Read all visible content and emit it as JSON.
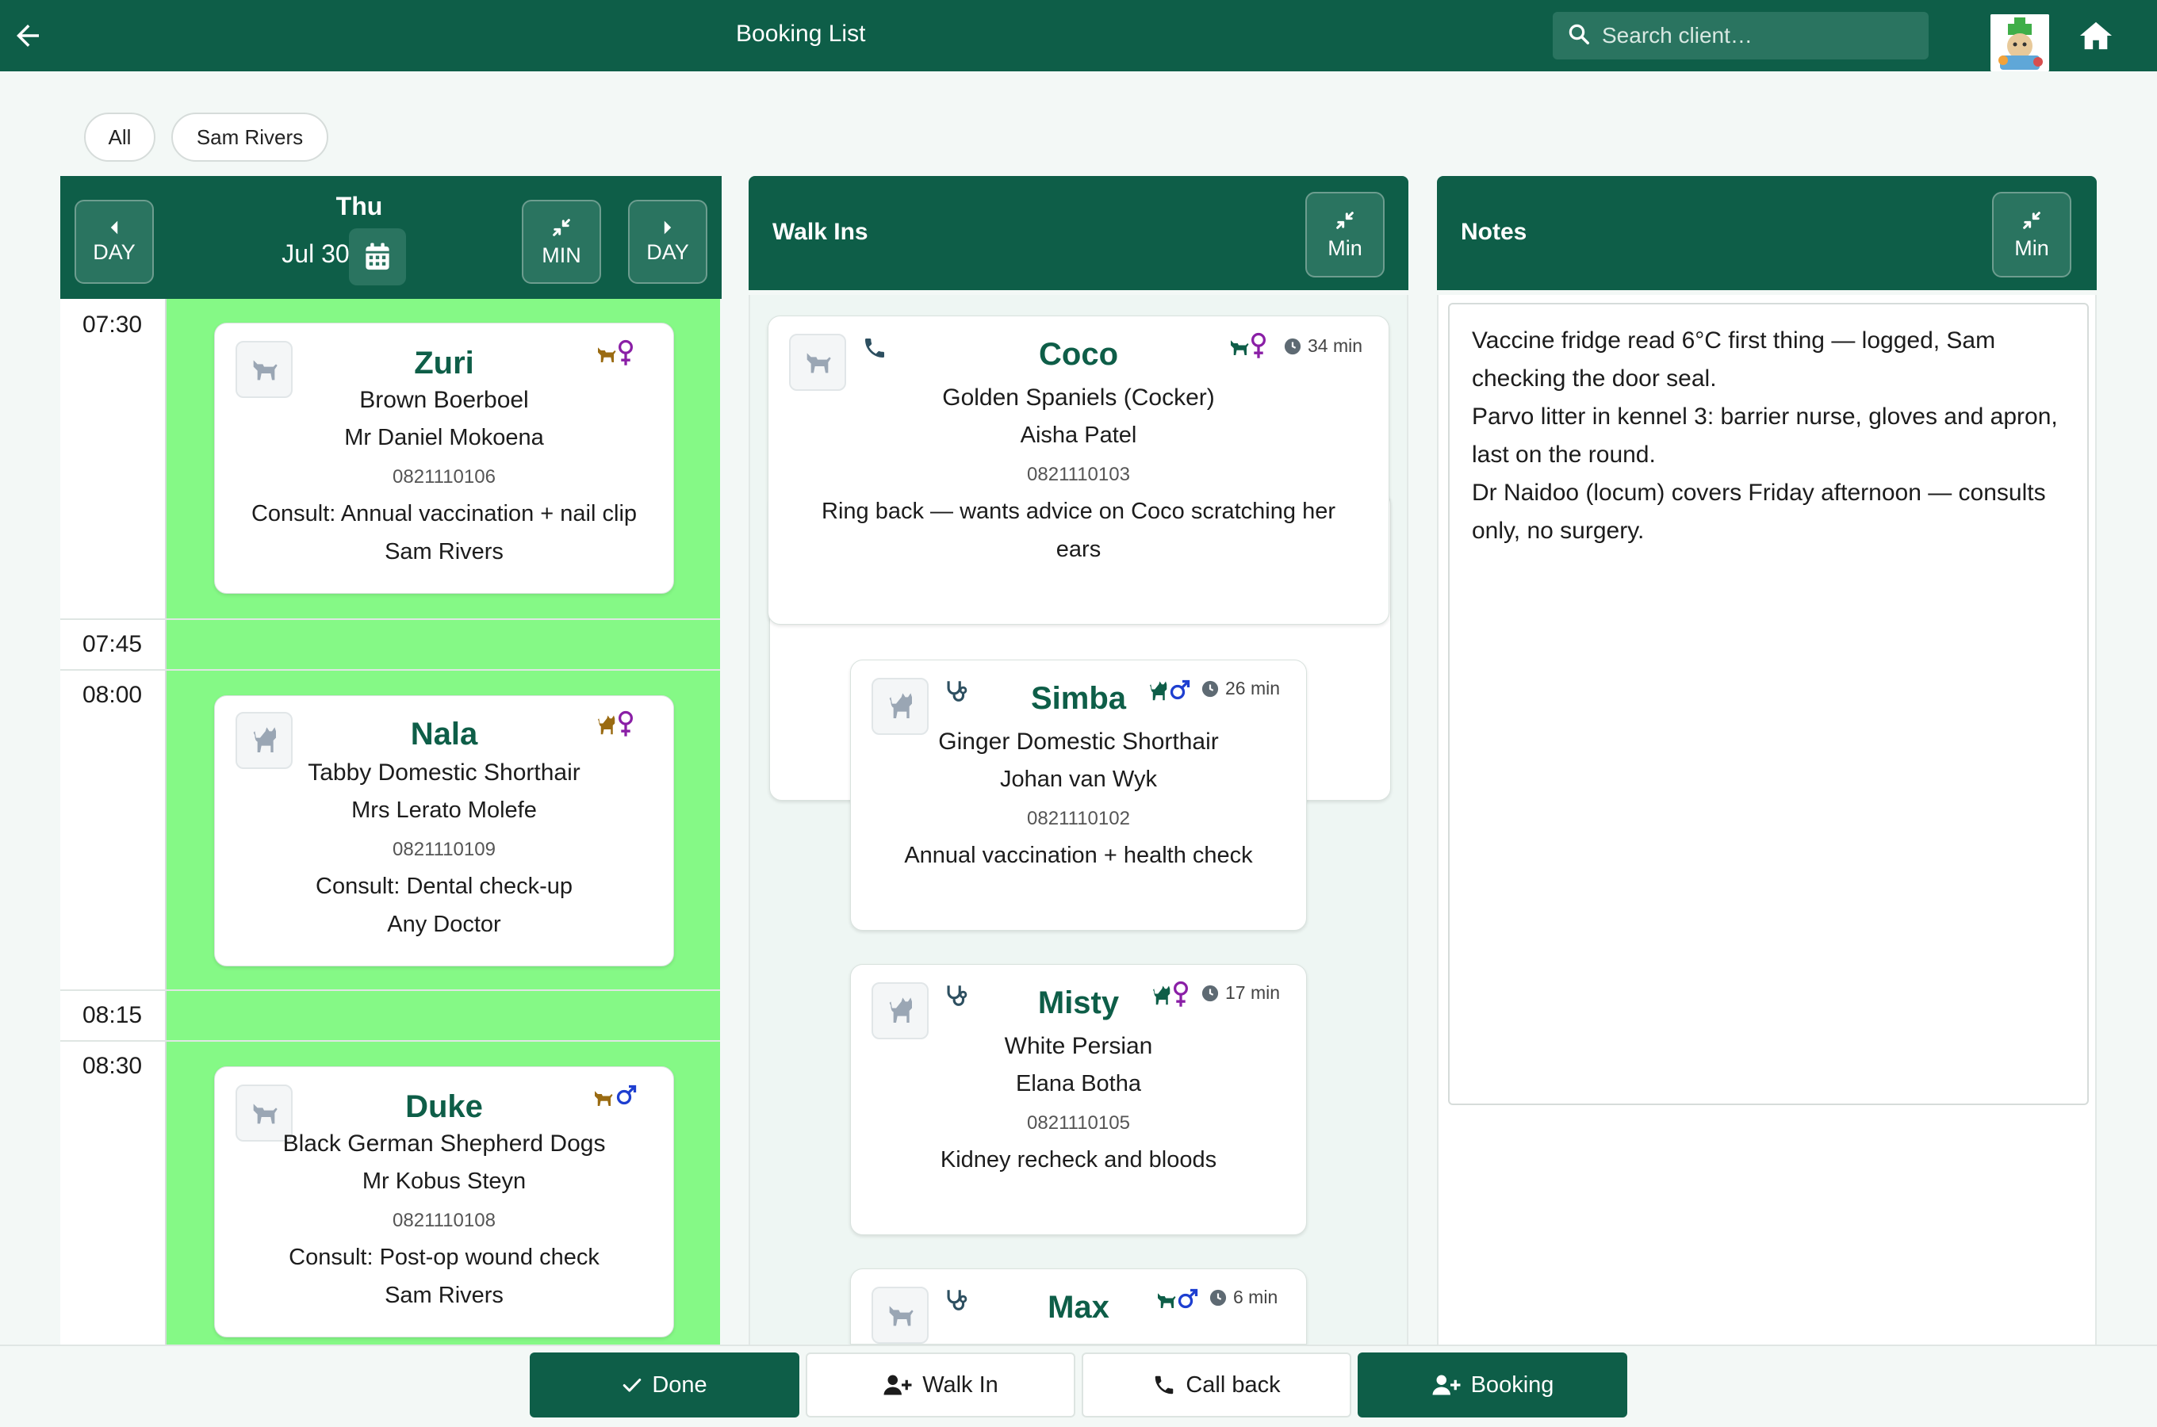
{
  "header": {
    "title": "Booking List",
    "search_placeholder": "Search client…",
    "back_icon": "arrow-left-icon",
    "home_icon": "home-icon"
  },
  "filters": {
    "all_label": "All",
    "vet_label": "Sam Rivers"
  },
  "schedule": {
    "prev_label": "DAY",
    "next_label": "DAY",
    "min_label": "MIN",
    "weekday": "Thu",
    "date": "Jul 30",
    "times": [
      "07:30",
      "07:45",
      "08:00",
      "08:15",
      "08:30"
    ],
    "bookings": [
      {
        "name": "Zuri",
        "breed": "Brown Boerboel",
        "owner": "Mr Daniel Mokoena",
        "phone": "0821110106",
        "reason": "Consult: Annual vaccination + nail clip",
        "vet": "Sam Rivers",
        "species": "dog",
        "sex": "female"
      },
      {
        "name": "Nala",
        "breed": "Tabby Domestic Shorthair",
        "owner": "Mrs Lerato Molefe",
        "phone": "0821110109",
        "reason": "Consult: Dental check-up",
        "vet": "Any Doctor",
        "species": "cat",
        "sex": "female"
      },
      {
        "name": "Duke",
        "breed": "Black German Shepherd Dogs",
        "owner": "Mr Kobus Steyn",
        "phone": "0821110108",
        "reason": "Consult: Post-op wound check",
        "vet": "Sam Rivers",
        "species": "dog",
        "sex": "male"
      }
    ]
  },
  "walkins": {
    "title": "Walk Ins",
    "min_label": "Min",
    "items": [
      {
        "name": "Coco",
        "breed": "Golden Spaniels (Cocker)",
        "owner": "Aisha Patel",
        "phone": "0821110103",
        "note_line1": "Ring back — wants advice on Coco scratching her",
        "note_line2": "ears",
        "wait": "34 min",
        "type_icon": "phone-icon",
        "species": "dog",
        "sex": "female"
      },
      {
        "name": "Simba",
        "breed": "Ginger Domestic Shorthair",
        "owner": "Johan van Wyk",
        "phone": "0821110102",
        "note_line1": "Annual vaccination + health check",
        "wait": "26 min",
        "type_icon": "stethoscope-icon",
        "species": "cat",
        "sex": "male"
      },
      {
        "name": "Misty",
        "breed": "White Persian",
        "owner": "Elana Botha",
        "phone": "0821110105",
        "note_line1": "Kidney recheck and bloods",
        "wait": "17 min",
        "type_icon": "stethoscope-icon",
        "species": "cat",
        "sex": "female"
      },
      {
        "name": "Max",
        "wait": "6 min",
        "type_icon": "stethoscope-icon",
        "species": "dog",
        "sex": "male"
      }
    ]
  },
  "notes": {
    "title": "Notes",
    "min_label": "Min",
    "text": "Vaccine fridge read 6°C first thing — logged, Sam checking the door seal.\nParvo litter in kennel 3: barrier nurse, gloves and apron, last on the round.\nDr Naidoo (locum) covers Friday afternoon — consults only, no surgery."
  },
  "actions": {
    "done": "Done",
    "walk_in": "Walk In",
    "call_back": "Call back",
    "booking": "Booking"
  },
  "colors": {
    "primary": "#0e5e48",
    "slot_green": "#85f986",
    "breed_brown": "#9a6b12",
    "breed_green": "#0e7e5a",
    "female": "#8a1fa6",
    "male": "#1e3fd0"
  }
}
